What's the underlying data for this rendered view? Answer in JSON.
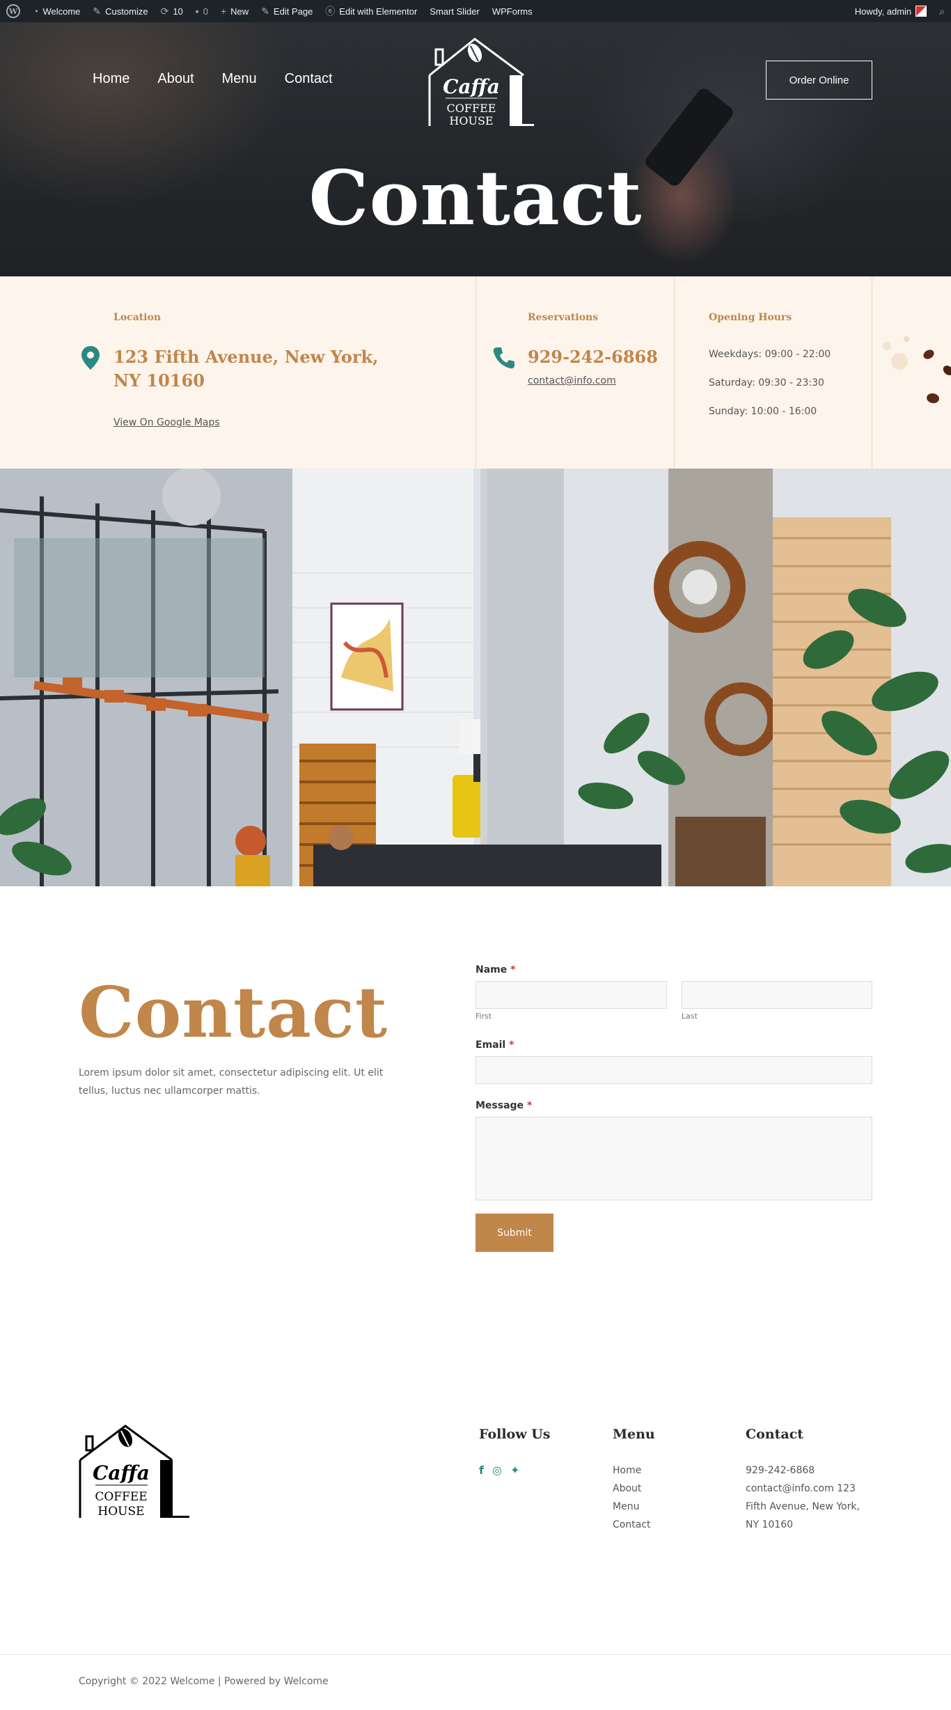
{
  "adminbar": {
    "welcome": "Welcome",
    "customize": "Customize",
    "updates": "10",
    "comments": "0",
    "new": "New",
    "edit_page": "Edit Page",
    "edit_elementor": "Edit with Elementor",
    "smart_slider": "Smart Slider",
    "wpforms": "WPForms",
    "howdy": "Howdy, admin"
  },
  "nav": {
    "items": [
      "Home",
      "About",
      "Menu",
      "Contact"
    ]
  },
  "logo": {
    "line1": "Caffa",
    "line2": "COFFEE",
    "line3": "HOUSE"
  },
  "header": {
    "order_button": "Order Online",
    "title": "Contact"
  },
  "info": {
    "location": {
      "label": "Location",
      "address_line1": "123 Fifth Avenue, New York,",
      "address_line2": "NY 10160",
      "map_link": "View On Google Maps"
    },
    "reservations": {
      "label": "Reservations",
      "phone": "929-242-6868",
      "email": "contact@info.com"
    },
    "hours": {
      "label": "Opening Hours",
      "weekdays": "Weekdays: 09:00 - 22:00",
      "saturday": "Saturday: 09:30 - 23:30",
      "sunday": "Sunday: 10:00 - 16:00"
    }
  },
  "contact_section": {
    "title": "Contact",
    "text": "Lorem ipsum dolor sit amet, consectetur adipiscing elit. Ut elit tellus, luctus nec ullamcorper mattis."
  },
  "form": {
    "name_label": "Name",
    "first_sub": "First",
    "last_sub": "Last",
    "email_label": "Email",
    "message_label": "Message",
    "required_mark": "*",
    "submit": "Submit"
  },
  "footer": {
    "follow_title": "Follow Us",
    "menu_title": "Menu",
    "menu_items": [
      "Home",
      "About",
      "Menu",
      "Contact"
    ],
    "contact_title": "Contact",
    "contact_lines": [
      "929-242-6868",
      "contact@info.com 123",
      "Fifth Avenue, New York,",
      "NY 10160"
    ],
    "copyright": "Copyright © 2022 Welcome | Powered by Welcome"
  },
  "colors": {
    "accent": "#c0864a",
    "teal": "#2a8a82",
    "cream": "#fdf4ec",
    "adminbar": "#1d2327"
  }
}
